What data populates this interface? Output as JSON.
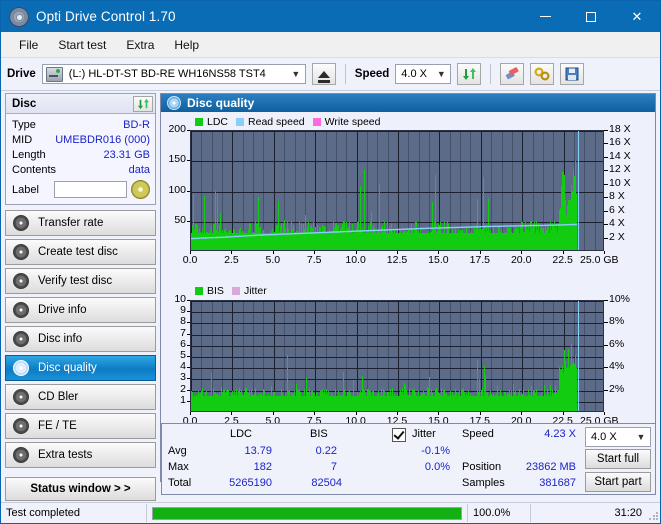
{
  "window": {
    "title": "Opti Drive Control 1.70",
    "minimize": "minimize-icon",
    "maximize": "maximize-icon",
    "close": "close-icon"
  },
  "menu": [
    "File",
    "Start test",
    "Extra",
    "Help"
  ],
  "toolbar": {
    "drive_label": "Drive",
    "drive_value": "(L:)  HL-DT-ST BD-RE  WH16NS58 TST4",
    "eject_icon": "eject-icon",
    "speed_label": "Speed",
    "speed_value": "4.0 X",
    "refresh_icon": "refresh-icon",
    "eraser_icon": "eraser-icon",
    "tools_icon": "tools-icon",
    "save_icon": "save-icon"
  },
  "disc": {
    "header": "Disc",
    "refresh_icon": "refresh-icon",
    "rows": [
      {
        "key": "Type",
        "value": "BD-R"
      },
      {
        "key": "MID",
        "value": "UMEBDR016 (000)"
      },
      {
        "key": "Length",
        "value": "23.31 GB"
      },
      {
        "key": "Contents",
        "value": "data"
      }
    ],
    "label_key": "Label",
    "label_value": "",
    "disc_icon": "disc-icon"
  },
  "nav": {
    "items": [
      {
        "label": "Transfer rate",
        "selected": false
      },
      {
        "label": "Create test disc",
        "selected": false
      },
      {
        "label": "Verify test disc",
        "selected": false
      },
      {
        "label": "Drive info",
        "selected": false
      },
      {
        "label": "Disc info",
        "selected": false
      },
      {
        "label": "Disc quality",
        "selected": true
      },
      {
        "label": "CD Bler",
        "selected": false
      },
      {
        "label": "FE / TE",
        "selected": false
      },
      {
        "label": "Extra tests",
        "selected": false
      }
    ],
    "status_window": "Status window > >"
  },
  "panel": {
    "title": "Disc quality",
    "icon": "disc-quality-icon"
  },
  "stats": {
    "col_ldc": "LDC",
    "col_bis": "BIS",
    "row_avg": "Avg",
    "row_max": "Max",
    "row_total": "Total",
    "ldc_avg": "13.79",
    "ldc_max": "182",
    "ldc_total": "5265190",
    "bis_avg": "0.22",
    "bis_max": "7",
    "bis_total": "82504",
    "jitter_label": "Jitter",
    "jitter_checked": true,
    "jitter_avg": "-0.1%",
    "jitter_max": "0.0%",
    "speed_label": "Speed",
    "speed_value": "4.23 X",
    "position_label": "Position",
    "position_value": "23862 MB",
    "samples_label": "Samples",
    "samples_value": "381687",
    "speed_select": "4.0 X",
    "start_full": "Start full",
    "start_part": "Start part"
  },
  "statusbar": {
    "message": "Test completed",
    "percent": "100.0%",
    "percent_value": 100,
    "elapsed": "31:20"
  },
  "colors": {
    "accent": "#0a6cb4",
    "ldc_green": "#12cc12",
    "read_speed": "#87cefa",
    "write_speed": "#ff69e0",
    "jitter": "#d9a8d9",
    "plot_bg": "#5c6c88",
    "value_blue": "#1a24c8"
  },
  "chart_data": [
    {
      "type": "bar",
      "name": "ldc-chart",
      "title": "",
      "xlabel": "GB",
      "ylabel": "LDC",
      "legend": [
        {
          "label": "LDC",
          "color": "#12cc12"
        },
        {
          "label": "Read speed",
          "color": "#87cefa"
        },
        {
          "label": "Write speed",
          "color": "#ff69e0"
        }
      ],
      "legend_position": "top-left",
      "grid": true,
      "xlim": [
        0,
        25.0
      ],
      "ylim": [
        0,
        200
      ],
      "xticks": [
        0.0,
        2.5,
        5.0,
        7.5,
        10.0,
        12.5,
        15.0,
        17.5,
        20.0,
        22.5,
        25.0
      ],
      "xtick_labels": [
        "0.0",
        "2.5",
        "5.0",
        "7.5",
        "10.0",
        "12.5",
        "15.0",
        "17.5",
        "20.0",
        "22.5",
        "25.0 GB"
      ],
      "yticks": [
        50,
        100,
        150,
        200
      ],
      "ytick_labels": [
        "50",
        "100",
        "150",
        "200"
      ],
      "y2lim": [
        0,
        18
      ],
      "y2ticks": [
        2,
        4,
        6,
        8,
        10,
        12,
        14,
        16,
        18
      ],
      "y2tick_labels": [
        "2 X",
        "4 X",
        "6 X",
        "8 X",
        "10 X",
        "12 X",
        "14 X",
        "16 X",
        "18 X"
      ],
      "data_end_x": 23.31,
      "cursor_x": 23.35,
      "base_envelope": [
        {
          "x": 0.0,
          "y": 120
        },
        {
          "x": 0.15,
          "y": 95
        },
        {
          "x": 0.4,
          "y": 88
        },
        {
          "x": 0.65,
          "y": 150
        },
        {
          "x": 0.9,
          "y": 75
        },
        {
          "x": 1.2,
          "y": 62
        },
        {
          "x": 1.55,
          "y": 152
        },
        {
          "x": 1.8,
          "y": 52
        },
        {
          "x": 2.2,
          "y": 44
        },
        {
          "x": 2.6,
          "y": 40
        },
        {
          "x": 3.0,
          "y": 42
        },
        {
          "x": 3.4,
          "y": 40
        },
        {
          "x": 3.9,
          "y": 135
        },
        {
          "x": 4.2,
          "y": 40
        },
        {
          "x": 4.6,
          "y": 38
        },
        {
          "x": 5.0,
          "y": 36
        },
        {
          "x": 5.35,
          "y": 110
        },
        {
          "x": 5.7,
          "y": 55
        },
        {
          "x": 6.1,
          "y": 60
        },
        {
          "x": 6.5,
          "y": 66
        },
        {
          "x": 6.9,
          "y": 70
        },
        {
          "x": 7.3,
          "y": 72
        },
        {
          "x": 7.7,
          "y": 68
        },
        {
          "x": 8.1,
          "y": 62
        },
        {
          "x": 8.5,
          "y": 58
        },
        {
          "x": 8.9,
          "y": 54
        },
        {
          "x": 9.2,
          "y": 165
        },
        {
          "x": 9.5,
          "y": 48
        },
        {
          "x": 9.9,
          "y": 44
        },
        {
          "x": 10.35,
          "y": 168
        },
        {
          "x": 10.6,
          "y": 120
        },
        {
          "x": 11.0,
          "y": 42
        },
        {
          "x": 11.4,
          "y": 155
        },
        {
          "x": 11.8,
          "y": 130
        },
        {
          "x": 12.1,
          "y": 40
        },
        {
          "x": 12.5,
          "y": 38
        },
        {
          "x": 13.0,
          "y": 36
        },
        {
          "x": 13.4,
          "y": 140
        },
        {
          "x": 13.8,
          "y": 38
        },
        {
          "x": 14.2,
          "y": 36
        },
        {
          "x": 14.7,
          "y": 140
        },
        {
          "x": 15.1,
          "y": 36
        },
        {
          "x": 15.5,
          "y": 120
        },
        {
          "x": 16.0,
          "y": 34
        },
        {
          "x": 16.5,
          "y": 36
        },
        {
          "x": 17.0,
          "y": 38
        },
        {
          "x": 17.45,
          "y": 160
        },
        {
          "x": 17.9,
          "y": 130
        },
        {
          "x": 18.3,
          "y": 40
        },
        {
          "x": 18.8,
          "y": 38
        },
        {
          "x": 19.3,
          "y": 42
        },
        {
          "x": 19.8,
          "y": 40
        },
        {
          "x": 20.2,
          "y": 130
        },
        {
          "x": 20.6,
          "y": 44
        },
        {
          "x": 21.0,
          "y": 120
        },
        {
          "x": 21.4,
          "y": 46
        },
        {
          "x": 21.8,
          "y": 120
        },
        {
          "x": 22.1,
          "y": 60
        },
        {
          "x": 22.4,
          "y": 150
        },
        {
          "x": 22.7,
          "y": 90
        },
        {
          "x": 22.95,
          "y": 130
        },
        {
          "x": 23.1,
          "y": 155
        },
        {
          "x": 23.25,
          "y": 165
        },
        {
          "x": 23.31,
          "y": 120
        }
      ],
      "read_speed_curve": [
        {
          "x": 0.0,
          "y": 2.0
        },
        {
          "x": 2.0,
          "y": 2.2
        },
        {
          "x": 4.0,
          "y": 2.5
        },
        {
          "x": 6.0,
          "y": 2.7
        },
        {
          "x": 8.0,
          "y": 2.9
        },
        {
          "x": 10.0,
          "y": 3.1
        },
        {
          "x": 12.0,
          "y": 3.3
        },
        {
          "x": 14.0,
          "y": 3.5
        },
        {
          "x": 16.0,
          "y": 3.65
        },
        {
          "x": 18.0,
          "y": 3.8
        },
        {
          "x": 20.0,
          "y": 3.9
        },
        {
          "x": 22.0,
          "y": 4.0
        },
        {
          "x": 23.31,
          "y": 4.1
        }
      ]
    },
    {
      "type": "bar",
      "name": "bis-chart",
      "title": "",
      "xlabel": "GB",
      "ylabel": "BIS",
      "legend": [
        {
          "label": "BIS",
          "color": "#12cc12"
        },
        {
          "label": "Jitter",
          "color": "#d9a8d9"
        }
      ],
      "legend_position": "top-left",
      "grid": true,
      "xlim": [
        0,
        25.0
      ],
      "ylim": [
        0,
        10
      ],
      "xticks": [
        0.0,
        2.5,
        5.0,
        7.5,
        10.0,
        12.5,
        15.0,
        17.5,
        20.0,
        22.5,
        25.0
      ],
      "xtick_labels": [
        "0.0",
        "2.5",
        "5.0",
        "7.5",
        "10.0",
        "12.5",
        "15.0",
        "17.5",
        "20.0",
        "22.5",
        "25.0 GB"
      ],
      "yticks": [
        1,
        2,
        3,
        4,
        5,
        6,
        7,
        8,
        9,
        10
      ],
      "ytick_labels": [
        "1",
        "2",
        "3",
        "4",
        "5",
        "6",
        "7",
        "8",
        "9",
        "10"
      ],
      "y2lim": [
        0,
        10
      ],
      "y2ticks": [
        2,
        4,
        6,
        8,
        10
      ],
      "y2tick_labels": [
        "2%",
        "4%",
        "6%",
        "8%",
        "10%"
      ],
      "data_end_x": 23.31,
      "cursor_x": 23.35,
      "base_envelope": [
        {
          "x": 0.0,
          "y": 5
        },
        {
          "x": 0.3,
          "y": 4
        },
        {
          "x": 0.6,
          "y": 5
        },
        {
          "x": 0.8,
          "y": 7
        },
        {
          "x": 1.0,
          "y": 6
        },
        {
          "x": 1.3,
          "y": 4
        },
        {
          "x": 1.8,
          "y": 3
        },
        {
          "x": 2.3,
          "y": 3
        },
        {
          "x": 2.8,
          "y": 3
        },
        {
          "x": 3.3,
          "y": 3
        },
        {
          "x": 3.9,
          "y": 6
        },
        {
          "x": 4.3,
          "y": 3
        },
        {
          "x": 4.8,
          "y": 3
        },
        {
          "x": 5.3,
          "y": 3
        },
        {
          "x": 5.9,
          "y": 6
        },
        {
          "x": 6.4,
          "y": 3
        },
        {
          "x": 6.9,
          "y": 3
        },
        {
          "x": 7.4,
          "y": 4
        },
        {
          "x": 7.9,
          "y": 3
        },
        {
          "x": 8.4,
          "y": 3
        },
        {
          "x": 8.9,
          "y": 5
        },
        {
          "x": 9.4,
          "y": 3
        },
        {
          "x": 9.9,
          "y": 3
        },
        {
          "x": 10.4,
          "y": 5
        },
        {
          "x": 10.9,
          "y": 3
        },
        {
          "x": 11.4,
          "y": 4
        },
        {
          "x": 11.9,
          "y": 3
        },
        {
          "x": 12.4,
          "y": 4
        },
        {
          "x": 13.0,
          "y": 3
        },
        {
          "x": 13.5,
          "y": 3
        },
        {
          "x": 14.0,
          "y": 4
        },
        {
          "x": 14.5,
          "y": 3
        },
        {
          "x": 15.0,
          "y": 5
        },
        {
          "x": 15.5,
          "y": 3
        },
        {
          "x": 16.0,
          "y": 3
        },
        {
          "x": 16.5,
          "y": 3
        },
        {
          "x": 17.0,
          "y": 4
        },
        {
          "x": 17.5,
          "y": 5
        },
        {
          "x": 18.0,
          "y": 4
        },
        {
          "x": 18.5,
          "y": 3
        },
        {
          "x": 19.0,
          "y": 3
        },
        {
          "x": 19.5,
          "y": 4
        },
        {
          "x": 20.0,
          "y": 3
        },
        {
          "x": 20.5,
          "y": 4
        },
        {
          "x": 21.0,
          "y": 3
        },
        {
          "x": 21.5,
          "y": 3
        },
        {
          "x": 22.0,
          "y": 4
        },
        {
          "x": 22.3,
          "y": 5
        },
        {
          "x": 22.6,
          "y": 6
        },
        {
          "x": 22.9,
          "y": 6
        },
        {
          "x": 23.1,
          "y": 6
        },
        {
          "x": 23.31,
          "y": 6
        }
      ]
    }
  ]
}
